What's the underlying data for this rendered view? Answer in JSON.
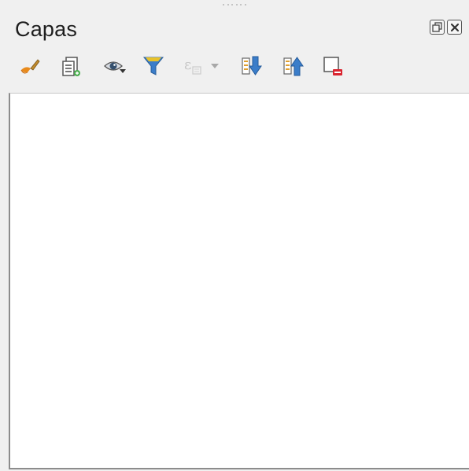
{
  "panel": {
    "title": "Capas"
  },
  "window_buttons": [
    {
      "name": "float-icon"
    },
    {
      "name": "close-icon"
    }
  ],
  "toolbar": {
    "icons": [
      "style-brush-icon",
      "add-group-icon",
      "manage-visibility-icon",
      "filter-legend-icon",
      "filter-expression-icon",
      "dropdown-arrow-icon",
      "expand-all-icon",
      "collapse-all-icon",
      "remove-layer-icon"
    ]
  },
  "colors": {
    "panel_bg": "#f0f0f0",
    "tree_bg": "#ffffff",
    "accent_blue": "#3b7dc9",
    "filter_yellow": "#e8c22a",
    "remove_red": "#d9242f"
  }
}
